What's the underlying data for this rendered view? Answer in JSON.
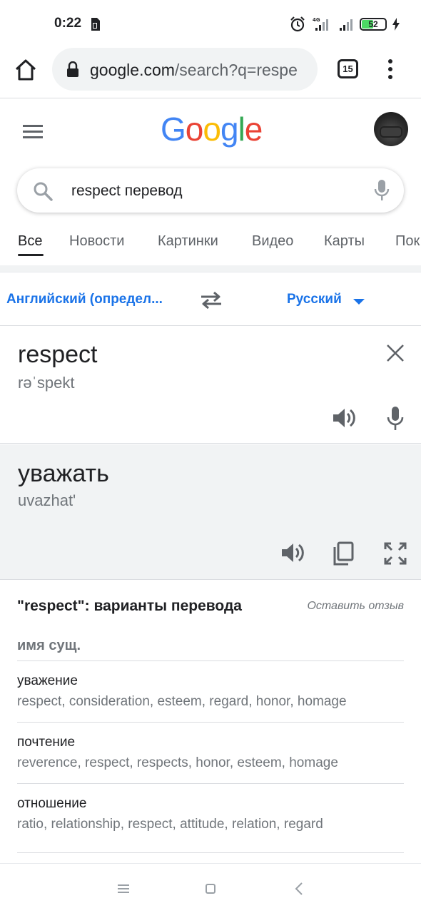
{
  "status_bar": {
    "time": "0:22",
    "network": "4G",
    "battery": "52",
    "battery_level_percent": 52
  },
  "browser": {
    "url_host": "google.com",
    "url_path": "/search?q=respe",
    "tab_count": "15"
  },
  "search": {
    "query": "respect перевод"
  },
  "tabs": [
    "Все",
    "Новости",
    "Картинки",
    "Видео",
    "Карты",
    "Пок"
  ],
  "translator": {
    "source_lang": "Английский (определ...",
    "target_lang": "Русский",
    "source_word": "respect",
    "source_phonetic": "rəˈspekt",
    "target_word": "уважать",
    "target_translit": "uvazhat'"
  },
  "definitions": {
    "title": "\"respect\": варианты перевода",
    "feedback": "Оставить отзыв",
    "part_of_speech": "имя сущ.",
    "entries": [
      {
        "word": "уважение",
        "synonyms": "respect, consideration, esteem, regard, honor, homage"
      },
      {
        "word": "почтение",
        "synonyms": "reverence, respect, respects, honor, esteem, homage"
      },
      {
        "word": "отношение",
        "synonyms": "ratio, relationship, respect, attitude, relation, regard"
      }
    ]
  },
  "colors": {
    "link_blue": "#1a73e8",
    "text": "#202124",
    "muted": "#70757a",
    "panel_gray": "#f1f3f4"
  },
  "icons": [
    "sim-icon",
    "alarm-icon",
    "signal-icon",
    "battery-icon",
    "charging-icon",
    "home-icon",
    "lock-icon",
    "tabs-icon",
    "more-vert-icon",
    "hamburger-icon",
    "search-icon",
    "mic-icon",
    "swap-icon",
    "caret-down-icon",
    "close-icon",
    "speaker-icon",
    "copy-icon",
    "fullscreen-icon",
    "nav-menu-icon",
    "nav-home-icon",
    "nav-back-icon"
  ]
}
